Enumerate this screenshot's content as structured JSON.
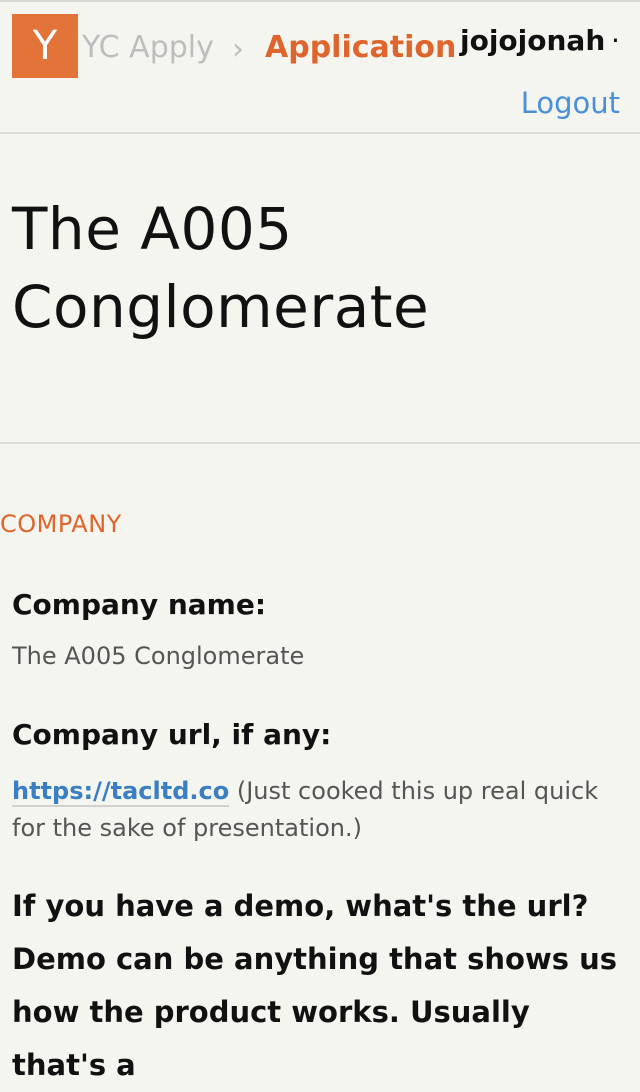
{
  "header": {
    "logo_letter": "Y",
    "breadcrumb_root": "YC Apply",
    "breadcrumb_separator": "›",
    "breadcrumb_current": "Application",
    "username": "jojojonah",
    "separator_dot": "·",
    "logout_label": "Logout"
  },
  "page": {
    "title": "The A005 Conglomerate"
  },
  "company": {
    "section_heading": "COMPANY",
    "name_question": "Company name:",
    "name_answer": "The A005 Conglomerate",
    "url_question": "Company url, if any:",
    "url_link": "https://tacltd.co",
    "url_note": " (Just cooked this up real quick for the sake of presentation.)",
    "demo_question": "If you have a demo, what's the url? Demo can be anything that shows us how the product works. Usually that's a"
  },
  "colors": {
    "accent_orange": "#e0652c",
    "logo_orange": "#e2743a",
    "link_blue": "#4a90d9",
    "background": "#f5f5f0"
  }
}
